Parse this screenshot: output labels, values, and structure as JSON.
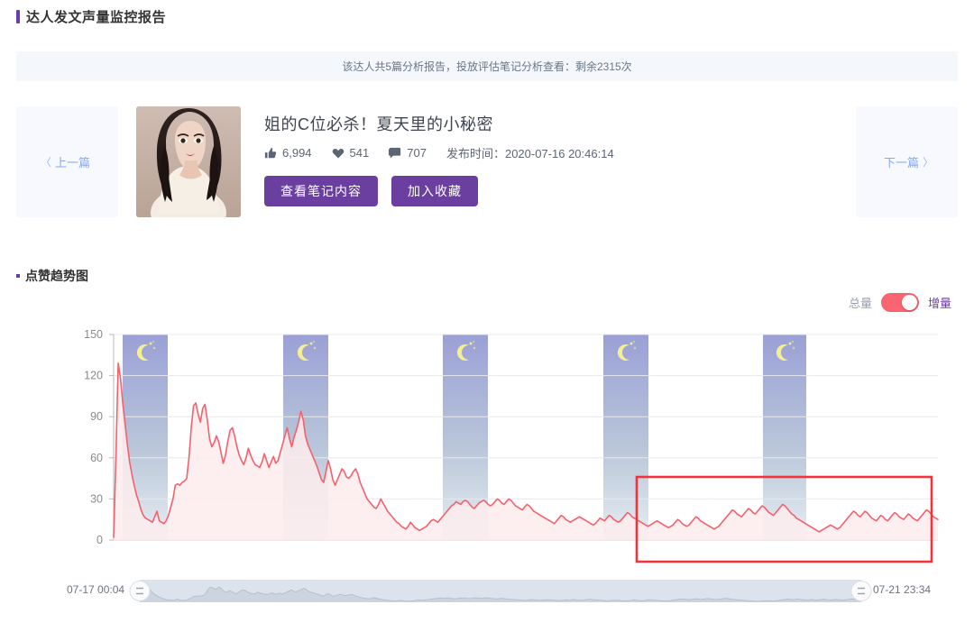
{
  "header": {
    "title": "达人发文声量监控报告"
  },
  "notice": {
    "text": "该达人共5篇分析报告，投放评估笔记分析查看：剩余2315次"
  },
  "card": {
    "prev_label": "上一篇",
    "prev_chevron": "〈",
    "next_label": "下一篇",
    "next_chevron": "〉",
    "note_title": "姐的C位必杀！夏天里的小秘密",
    "stats": [
      {
        "icon": "thumbs-up-icon",
        "value": "6,994"
      },
      {
        "icon": "heart-icon",
        "value": "541"
      },
      {
        "icon": "comment-icon",
        "value": "707"
      }
    ],
    "publish_label": "发布时间：",
    "publish_time": "2020-07-16 20:46:14",
    "buttons": [
      {
        "name": "view-note-button",
        "label": "查看笔记内容"
      },
      {
        "name": "add-favorite-button",
        "label": "加入收藏"
      }
    ]
  },
  "section": {
    "title": "点赞趋势图"
  },
  "toggle": {
    "off_label": "总量",
    "on_label": "增量",
    "state": "on",
    "active_color": "#fa6570",
    "on_text_color": "#6b3fa0",
    "off_text_color": "#9aa1ac"
  },
  "chart_data": {
    "type": "area",
    "title": "点赞趋势图",
    "xlabel": "",
    "ylabel": "",
    "ylim": [
      0,
      150
    ],
    "yticks": [
      0,
      30,
      60,
      90,
      120,
      150
    ],
    "ytick_labels": [
      "0",
      "30",
      "60",
      "90",
      "120",
      "150"
    ],
    "grid": true,
    "legend": "none",
    "line_color": "#f4616d",
    "fill_color": "#fdeced",
    "x_range": [
      "07-17 00:04",
      "07-21 23:34"
    ],
    "night_band_color_top": "#9aa0d6",
    "night_band_color_bottom": "#e7eef2",
    "night_band_icon": "moon-stars-icon",
    "night_bands": [
      {
        "start": "07-17 00:04",
        "end": "07-17 06:00"
      },
      {
        "start": "07-17 22:00",
        "end": "07-18 06:00"
      },
      {
        "start": "07-18 22:00",
        "end": "07-19 06:00"
      },
      {
        "start": "07-19 22:00",
        "end": "07-20 06:00"
      },
      {
        "start": "07-20 22:00",
        "end": "07-21 06:00"
      }
    ],
    "annotation": {
      "type": "rectangle",
      "color": "#f3333c",
      "x_start": "07-20 09:00",
      "x_end": "07-21 23:34",
      "y_start": 0,
      "y_end": 30
    },
    "values": [
      2,
      60,
      129,
      118,
      100,
      85,
      70,
      57,
      48,
      40,
      33,
      28,
      22,
      18,
      16,
      15,
      14,
      13,
      17,
      21,
      14,
      13,
      12,
      14,
      18,
      24,
      30,
      40,
      41,
      40,
      42,
      43,
      45,
      60,
      82,
      98,
      100,
      92,
      86,
      96,
      99,
      88,
      74,
      68,
      71,
      76,
      72,
      64,
      56,
      62,
      72,
      80,
      82,
      76,
      68,
      62,
      58,
      55,
      60,
      67,
      62,
      58,
      55,
      54,
      53,
      57,
      63,
      58,
      53,
      57,
      61,
      56,
      58,
      64,
      70,
      76,
      82,
      74,
      68,
      75,
      80,
      86,
      94,
      88,
      76,
      70,
      66,
      62,
      58,
      54,
      49,
      44,
      42,
      50,
      58,
      52,
      44,
      40,
      44,
      48,
      52,
      50,
      46,
      45,
      47,
      50,
      52,
      48,
      42,
      38,
      34,
      30,
      28,
      26,
      24,
      23,
      26,
      30,
      27,
      24,
      21,
      19,
      17,
      15,
      13,
      12,
      10,
      9,
      8,
      10,
      13,
      11,
      9,
      8,
      7,
      8,
      9,
      10,
      12,
      14,
      15,
      14,
      13,
      15,
      17,
      19,
      21,
      23,
      25,
      26,
      28,
      27,
      26,
      28,
      29,
      28,
      26,
      24,
      23,
      25,
      27,
      28,
      29,
      28,
      26,
      25,
      26,
      28,
      30,
      29,
      27,
      26,
      28,
      30,
      29,
      27,
      25,
      24,
      23,
      22,
      24,
      26,
      25,
      23,
      21,
      20,
      19,
      18,
      17,
      16,
      15,
      14,
      13,
      12,
      14,
      16,
      18,
      17,
      15,
      14,
      13,
      14,
      15,
      16,
      17,
      16,
      15,
      14,
      13,
      12,
      11,
      12,
      14,
      16,
      15,
      14,
      16,
      18,
      17,
      15,
      14,
      13,
      14,
      16,
      18,
      20,
      19,
      17,
      16,
      15,
      14,
      13,
      12,
      11,
      10,
      11,
      12,
      13,
      14,
      13,
      12,
      11,
      10,
      9,
      10,
      11,
      13,
      15,
      14,
      12,
      11,
      10,
      11,
      13,
      15,
      17,
      16,
      14,
      13,
      12,
      11,
      10,
      9,
      8,
      9,
      10,
      12,
      14,
      16,
      18,
      20,
      22,
      21,
      19,
      18,
      17,
      19,
      21,
      23,
      22,
      20,
      19,
      21,
      23,
      25,
      24,
      22,
      20,
      19,
      18,
      20,
      22,
      24,
      26,
      25,
      23,
      21,
      19,
      18,
      16,
      15,
      14,
      13,
      12,
      11,
      10,
      9,
      8,
      7,
      6,
      7,
      8,
      9,
      10,
      11,
      10,
      9,
      8,
      9,
      11,
      13,
      15,
      17,
      19,
      21,
      20,
      18,
      17,
      19,
      21,
      20,
      18,
      16,
      15,
      14,
      16,
      18,
      17,
      15,
      14,
      16,
      18,
      20,
      19,
      17,
      16,
      15,
      17,
      19,
      18,
      16,
      15,
      14,
      16,
      18,
      20,
      22,
      21,
      19,
      17,
      16,
      15
    ]
  },
  "brush": {
    "start_label": "07-17 00:04",
    "end_label": "07-21 23:34",
    "handle_icon": "drag-handle-icon"
  }
}
